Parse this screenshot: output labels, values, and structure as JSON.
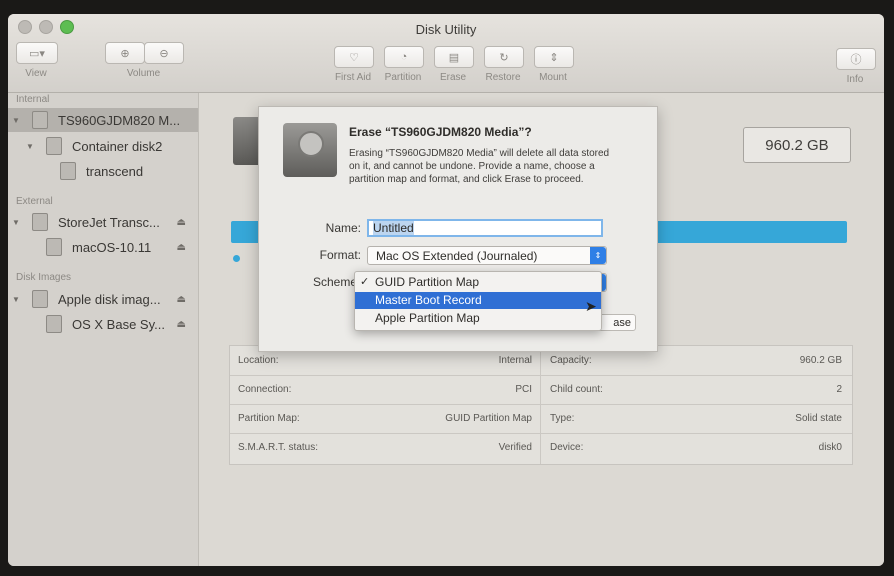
{
  "window": {
    "title": "Disk Utility"
  },
  "toolbar": {
    "view_label": "View",
    "volume_label": "Volume",
    "first_aid_label": "First Aid",
    "partition_label": "Partition",
    "erase_label": "Erase",
    "restore_label": "Restore",
    "mount_label": "Mount",
    "info_label": "Info"
  },
  "sidebar": {
    "internal_header": "Internal",
    "external_header": "External",
    "images_header": "Disk Images",
    "items": [
      {
        "label": "TS960GJDM820 M..."
      },
      {
        "label": "Container disk2"
      },
      {
        "label": "transcend"
      },
      {
        "label": "StoreJet Transc..."
      },
      {
        "label": "macOS-10.11"
      },
      {
        "label": "Apple disk imag..."
      },
      {
        "label": "OS X Base Sy..."
      }
    ]
  },
  "main": {
    "capacity_display": "960.2 GB",
    "info": {
      "location_label": "Location:",
      "location_value": "Internal",
      "capacity_label": "Capacity:",
      "capacity_value": "960.2 GB",
      "connection_label": "Connection:",
      "connection_value": "PCI",
      "child_label": "Child count:",
      "child_value": "2",
      "partition_label": "Partition Map:",
      "partition_value": "GUID Partition Map",
      "type_label": "Type:",
      "type_value": "Solid state",
      "smart_label": "S.M.A.R.T. status:",
      "smart_value": "Verified",
      "device_label": "Device:",
      "device_value": "disk0"
    }
  },
  "dialog": {
    "title": "Erase “TS960GJDM820 Media”?",
    "description": "Erasing “TS960GJDM820 Media” will delete all data stored on it, and cannot be undone. Provide a name, choose a partition map and format, and click Erase to proceed.",
    "name_label": "Name:",
    "name_value": "Untitled",
    "format_label": "Format:",
    "format_value": "Mac OS Extended (Journaled)",
    "scheme_label": "Scheme",
    "erase_button_partial": "ase",
    "scheme_options": [
      {
        "label": "GUID Partition Map",
        "checked": true
      },
      {
        "label": "Master Boot Record",
        "highlighted": true
      },
      {
        "label": "Apple Partition Map"
      }
    ],
    "check_mark": "✓"
  },
  "colors": {
    "accent": "#2f6fd4",
    "usage_bar": "#36a7d8"
  }
}
